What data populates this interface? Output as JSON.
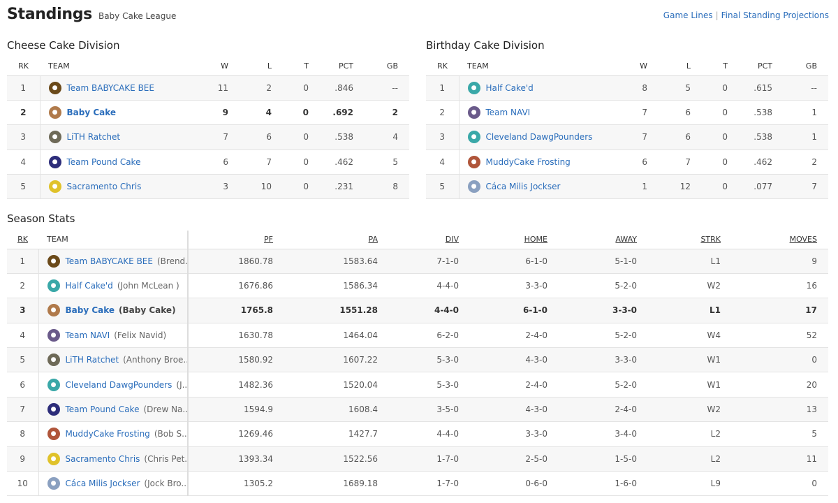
{
  "header": {
    "title": "Standings",
    "league": "Baby Cake League",
    "links": [
      "Game Lines",
      "Final Standing Projections"
    ]
  },
  "divisions": [
    {
      "name": "Cheese Cake Division",
      "columns": [
        "RK",
        "TEAM",
        "W",
        "L",
        "T",
        "PCT",
        "GB"
      ],
      "rows": [
        {
          "rk": "1",
          "team": "Team BABYCAKE BEE",
          "w": "11",
          "l": "2",
          "t": "0",
          "pct": ".846",
          "gb": "--",
          "logo": "#6b4a1a",
          "icon": "bee-helmet-icon"
        },
        {
          "rk": "2",
          "team": "Baby Cake",
          "w": "9",
          "l": "4",
          "t": "0",
          "pct": ".692",
          "gb": "2",
          "logo": "#b07a4b",
          "icon": "cat-icon",
          "bold": true
        },
        {
          "rk": "3",
          "team": "LiTH Ratchet",
          "w": "7",
          "l": "6",
          "t": "0",
          "pct": ".538",
          "gb": "4",
          "logo": "#6e6a58",
          "icon": "badge-icon"
        },
        {
          "rk": "4",
          "team": "Team Pound Cake",
          "w": "6",
          "l": "7",
          "t": "0",
          "pct": ".462",
          "gb": "5",
          "logo": "#2d2d7a",
          "icon": "helmet-icon"
        },
        {
          "rk": "5",
          "team": "Sacramento Chris",
          "w": "3",
          "l": "10",
          "t": "0",
          "pct": ".231",
          "gb": "8",
          "logo": "#e0c22a",
          "icon": "helmet-icon"
        }
      ]
    },
    {
      "name": "Birthday Cake Division",
      "columns": [
        "RK",
        "TEAM",
        "W",
        "L",
        "T",
        "PCT",
        "GB"
      ],
      "rows": [
        {
          "rk": "1",
          "team": "Half Cake'd",
          "w": "8",
          "l": "5",
          "t": "0",
          "pct": ".615",
          "gb": "--",
          "logo": "#3aa8a8",
          "icon": "helmet-icon"
        },
        {
          "rk": "2",
          "team": "Team NAVI",
          "w": "7",
          "l": "6",
          "t": "0",
          "pct": ".538",
          "gb": "1",
          "logo": "#6a5a8a",
          "icon": "emblem-icon"
        },
        {
          "rk": "3",
          "team": "Cleveland DawgPounders",
          "w": "7",
          "l": "6",
          "t": "0",
          "pct": ".538",
          "gb": "1",
          "logo": "#3aa8a8",
          "icon": "helmet-icon"
        },
        {
          "rk": "4",
          "team": "MuddyCake Frosting",
          "w": "6",
          "l": "7",
          "t": "0",
          "pct": ".462",
          "gb": "2",
          "logo": "#b0553a",
          "icon": "square-logo-icon"
        },
        {
          "rk": "5",
          "team": "Cáca Milis Jockser",
          "w": "1",
          "l": "12",
          "t": "0",
          "pct": ".077",
          "gb": "7",
          "logo": "#8aa0c0",
          "icon": "emblem-icon"
        }
      ]
    }
  ],
  "season": {
    "title": "Season Stats",
    "columns": [
      "RK",
      "TEAM",
      "PF",
      "PA",
      "DIV",
      "HOME",
      "AWAY",
      "STRK",
      "MOVES"
    ],
    "rows": [
      {
        "rk": "1",
        "team": "Team BABYCAKE BEE",
        "owner": "(Brend...",
        "pf": "1860.78",
        "pa": "1583.64",
        "div": "7-1-0",
        "home": "6-1-0",
        "away": "5-1-0",
        "strk": "L1",
        "moves": "9",
        "logo": "#6b4a1a",
        "icon": "bee-helmet-icon"
      },
      {
        "rk": "2",
        "team": "Half Cake'd",
        "owner": "(John McLean )",
        "pf": "1676.86",
        "pa": "1586.34",
        "div": "4-4-0",
        "home": "3-3-0",
        "away": "5-2-0",
        "strk": "W2",
        "moves": "16",
        "logo": "#3aa8a8",
        "icon": "helmet-icon"
      },
      {
        "rk": "3",
        "team": "Baby Cake",
        "owner": "(Baby Cake)",
        "pf": "1765.8",
        "pa": "1551.28",
        "div": "4-4-0",
        "home": "6-1-0",
        "away": "3-3-0",
        "strk": "L1",
        "moves": "17",
        "logo": "#b07a4b",
        "icon": "cat-icon",
        "bold": true
      },
      {
        "rk": "4",
        "team": "Team NAVI",
        "owner": "(Felix Navid)",
        "pf": "1630.78",
        "pa": "1464.04",
        "div": "6-2-0",
        "home": "2-4-0",
        "away": "5-2-0",
        "strk": "W4",
        "moves": "52",
        "logo": "#6a5a8a",
        "icon": "emblem-icon"
      },
      {
        "rk": "5",
        "team": "LiTH Ratchet",
        "owner": "(Anthony Broe...",
        "pf": "1580.92",
        "pa": "1607.22",
        "div": "5-3-0",
        "home": "4-3-0",
        "away": "3-3-0",
        "strk": "W1",
        "moves": "0",
        "logo": "#6e6a58",
        "icon": "badge-icon"
      },
      {
        "rk": "6",
        "team": "Cleveland DawgPounders",
        "owner": "(J...",
        "pf": "1482.36",
        "pa": "1520.04",
        "div": "5-3-0",
        "home": "2-4-0",
        "away": "5-2-0",
        "strk": "W1",
        "moves": "20",
        "logo": "#3aa8a8",
        "icon": "helmet-icon"
      },
      {
        "rk": "7",
        "team": "Team Pound Cake",
        "owner": "(Drew Na...",
        "pf": "1594.9",
        "pa": "1608.4",
        "div": "3-5-0",
        "home": "4-3-0",
        "away": "2-4-0",
        "strk": "W2",
        "moves": "13",
        "logo": "#2d2d7a",
        "icon": "helmet-icon"
      },
      {
        "rk": "8",
        "team": "MuddyCake Frosting",
        "owner": "(Bob S...",
        "pf": "1269.46",
        "pa": "1427.7",
        "div": "4-4-0",
        "home": "3-3-0",
        "away": "3-4-0",
        "strk": "L2",
        "moves": "5",
        "logo": "#b0553a",
        "icon": "square-logo-icon"
      },
      {
        "rk": "9",
        "team": "Sacramento Chris",
        "owner": "(Chris Pet...",
        "pf": "1393.34",
        "pa": "1522.56",
        "div": "1-7-0",
        "home": "2-5-0",
        "away": "1-5-0",
        "strk": "L2",
        "moves": "11",
        "logo": "#e0c22a",
        "icon": "helmet-icon"
      },
      {
        "rk": "10",
        "team": "Cáca Milis Jockser",
        "owner": "(Jock Bro...",
        "pf": "1305.2",
        "pa": "1689.18",
        "div": "1-7-0",
        "home": "0-6-0",
        "away": "1-6-0",
        "strk": "L9",
        "moves": "0",
        "logo": "#8aa0c0",
        "icon": "emblem-icon"
      }
    ]
  },
  "colors": {
    "link": "#2a6dbb",
    "stripe": "#f7f7f7"
  }
}
